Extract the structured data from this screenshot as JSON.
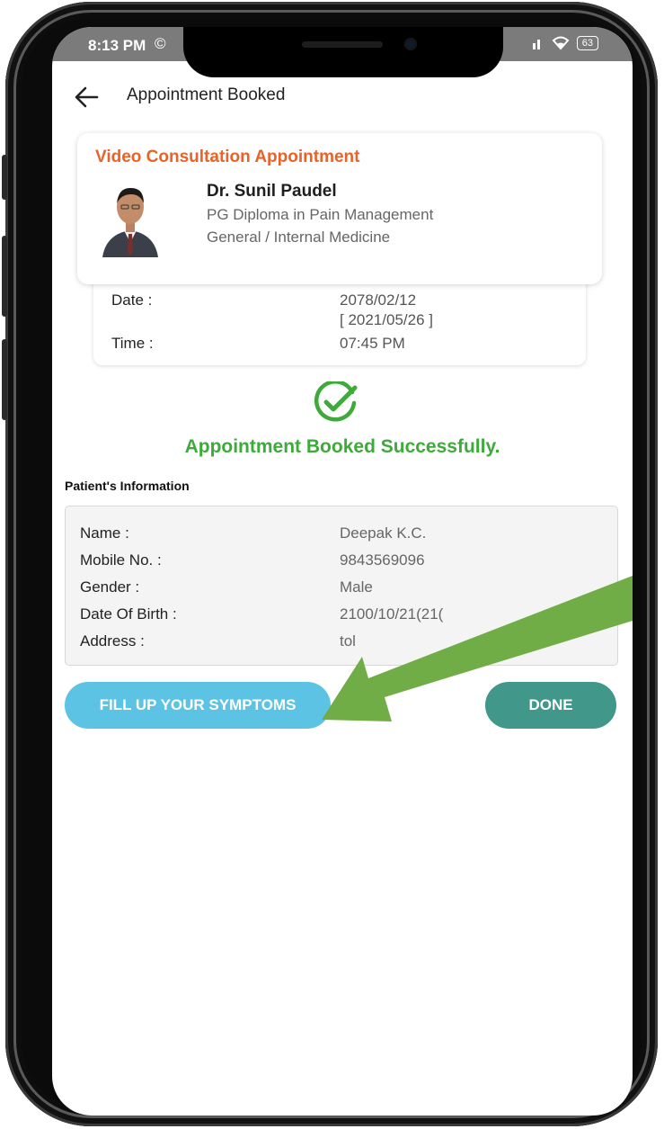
{
  "status_bar": {
    "time": "8:13 PM",
    "extra_glyph": "©",
    "battery": "63"
  },
  "header": {
    "title": "Appointment Booked"
  },
  "appointment": {
    "type": "Video Consultation Appointment",
    "doctor_name": "Dr. Sunil Paudel",
    "qualification": "PG Diploma in Pain Management",
    "specialty": "General  / Internal Medicine",
    "date_label": "Date :",
    "date_bs": "2078/02/12",
    "date_ad": "[ 2021/05/26 ]",
    "time_label": "Time :",
    "time_value": "07:45 PM"
  },
  "success_message": "Appointment Booked Successfully.",
  "patient_section_title": "Patient's Information",
  "patient": {
    "rows": [
      {
        "label": "Name :",
        "value": "Deepak K.C."
      },
      {
        "label": "Mobile No. :",
        "value": "9843569096"
      },
      {
        "label": "Gender :",
        "value": "Male"
      },
      {
        "label": "Date Of Birth :",
        "value": "2100/10/21(21("
      },
      {
        "label": "Address :",
        "value": "tol"
      }
    ]
  },
  "buttons": {
    "symptoms": "FILL UP YOUR SYMPTOMS",
    "done": "DONE"
  },
  "colors": {
    "accent_orange": "#e8632a",
    "success_green": "#3daa3a",
    "symptoms_button": "#5dc3e5",
    "done_button": "#41988a",
    "annotation_arrow": "#70ad47"
  },
  "icons": {
    "back": "arrow-left-icon",
    "success": "check-circle-icon",
    "status": [
      "signal-icon",
      "wifi-icon",
      "battery-icon"
    ]
  }
}
